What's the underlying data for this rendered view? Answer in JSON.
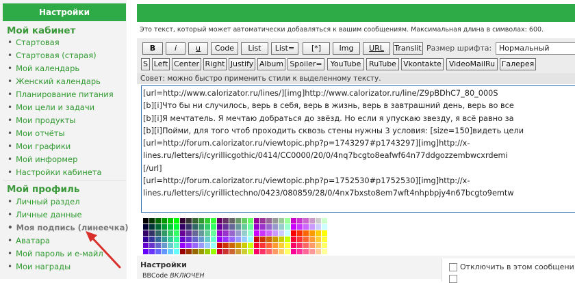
{
  "sidebar": {
    "header": "Настройки",
    "section1": {
      "title": "Мой кабинет",
      "items": [
        "Стартовая",
        "Стартовая (старая)",
        "Мой календарь",
        "Женский календарь",
        "Планирование питания",
        "Мои цели и задачи",
        "Мои продукты",
        "Мои отчёты",
        "Мои графики",
        "Мой информер",
        "Настройки кабинета"
      ]
    },
    "section2": {
      "title": "Мой профиль",
      "items": [
        "Личный раздел",
        "Личные данные",
        "Моя подпись (линеечка)",
        "Аватара",
        "Мой пароль и e-майл",
        "Мои награды"
      ],
      "active_index": 2
    }
  },
  "main": {
    "note": "Это текст, который может автоматически добавляться к вашим сообщениям. Максимальная длина в символах: 600.",
    "toolbar": {
      "row1": [
        "B",
        "i",
        "u",
        "Code",
        "List",
        "List=",
        "[*]",
        "Img",
        "URL",
        "Translit"
      ],
      "font_size_label": "Размер шрифта:",
      "font_size_value": "Нормальный",
      "row2": [
        "S",
        "Left",
        "Center",
        "Right",
        "Justify",
        "Album",
        "Spoiler=",
        "YouTube",
        "RuTube",
        "Vkontakte",
        "VideoMailRu",
        "Галерея"
      ],
      "hint": "Совет: можно быстро применить стили к выделенному тексту."
    },
    "editor_lines": [
      "[url=http://www.calorizator.ru/lines/][img]http://www.calorizator.ru/line/Z9pBDhC7_80_000S",
      "[b][i]Что бы ни случилось, верь в себя, верь в жизнь, верь в завтрашний день, верь во все",
      "[b][i]Я мечтатель. Я мечтаю добраться до звёзд. Но если я упускаю звезду, я всё равно за",
      "[b][i]Пойми, для того чтоб проходить сквозь стены нужны 3 условия: [size=150]видеть цели",
      "[url=http://forum.calorizator.ru/viewtopic.php?p=1743297#p1743297][img]http://x-",
      "lines.ru/letters/i/cyrillicgothic/0414/CC0000/20/0/4nq7bcgto8eafwf64n77ddgozzembwcxrdemi",
      "[/url]",
      "[url=http://forum.calorizator.ru/viewtopic.php?p=1752530#p1752530][img]http://x-",
      "lines.ru/letters/i/cyrillictechno/0423/080859/28/0/4nx7bxsto8em7wft4nhpbpjy4n67bcgto9emtw"
    ],
    "settings": {
      "label": "Настройки",
      "bbcode_prefix": "BBCode",
      "bbcode_state": "ВКЛЮЧЕН",
      "disable_option": "Отключить в этом сообщени"
    }
  },
  "colors": {
    "accent_green": "#2eaa46",
    "link_green": "#2e9a2e",
    "arrow_red": "#d9302c",
    "editor_border": "#2b6cb3"
  },
  "icons": [
    "arrow-icon"
  ]
}
